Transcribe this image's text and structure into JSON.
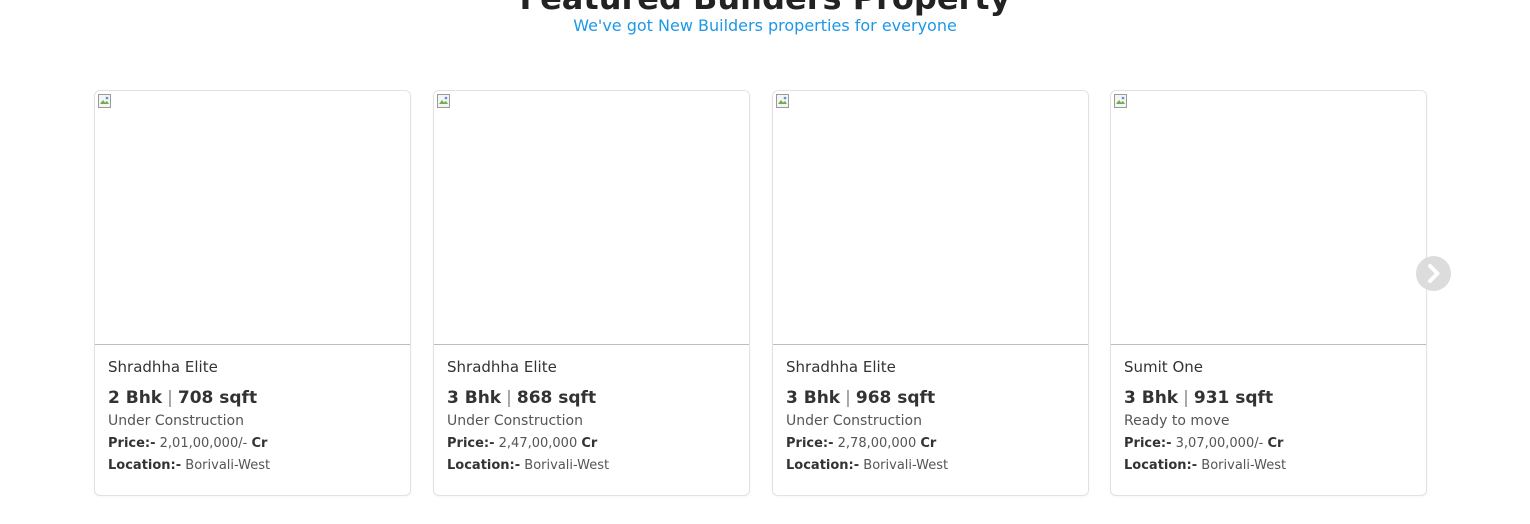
{
  "header": {
    "title": "Featured Builders Property",
    "subtitle": "We've got New Builders properties for everyone"
  },
  "labels": {
    "price": "Price:-",
    "location": "Location:-",
    "separator": "|"
  },
  "cards": [
    {
      "name": "Shradhha Elite",
      "bhk": "2 Bhk",
      "area": "708 sqft",
      "status": "Under Construction",
      "price": "2,01,00,000/-",
      "unit": "Cr",
      "location": "Borivali-West"
    },
    {
      "name": "Shradhha Elite",
      "bhk": "3 Bhk",
      "area": "868 sqft",
      "status": "Under Construction",
      "price": "2,47,00,000",
      "unit": "Cr",
      "location": "Borivali-West"
    },
    {
      "name": "Shradhha Elite",
      "bhk": "3 Bhk",
      "area": "968 sqft",
      "status": "Under Construction",
      "price": "2,78,00,000",
      "unit": "Cr",
      "location": "Borivali-West"
    },
    {
      "name": "Sumit One",
      "bhk": "3 Bhk",
      "area": "931 sqft",
      "status": "Ready to move",
      "price": "3,07,00,000/-",
      "unit": "Cr",
      "location": "Borivali-West"
    }
  ],
  "carousel": {
    "next_icon": "chevron-right-icon"
  },
  "colors": {
    "subtitle": "#1e97e6",
    "card_border": "#e2e2e2",
    "nav_button": "#dcdcdc"
  }
}
